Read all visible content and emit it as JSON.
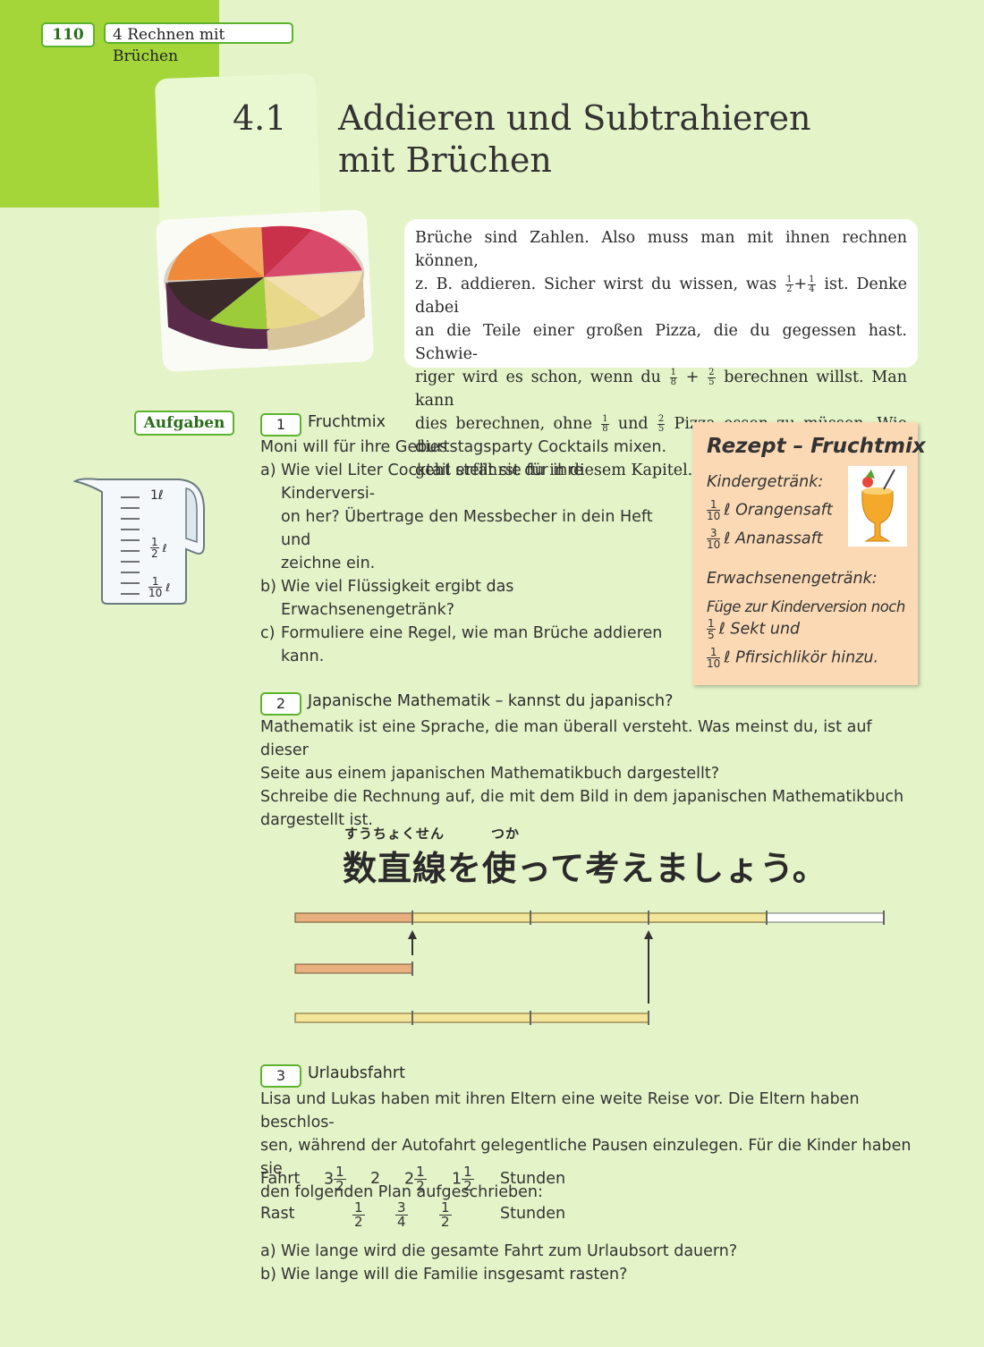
{
  "header": {
    "page_number": "110",
    "chapter": "4 Rechnen mit Brüchen"
  },
  "section": {
    "number": "4.1",
    "title_line1": "Addieren und Subtrahieren",
    "title_line2": "mit Brüchen"
  },
  "intro": {
    "p1": "Brüche sind Zahlen. Also muss man mit ihnen rechnen können,",
    "p2a": "z. B. addieren. Sicher wirst du wissen, was ",
    "p2b": " ist. Denke dabei",
    "p3": "an die Teile einer großen Pizza, die du gegessen hast. Schwie-",
    "p4a": "riger wird es schon, wenn du ",
    "p4b": " berechnen willst. Man kann",
    "p5a": "dies berechnen, ohne ",
    "p5b": " und ",
    "p5c": " Pizza essen zu müssen. Wie dies",
    "p6": "geht erfährst du in diesem Kapitel.",
    "plus": "+",
    "f_half_n": "1",
    "f_half_d": "2",
    "f_quarter_n": "1",
    "f_quarter_d": "4",
    "f_eighth_n": "1",
    "f_eighth_d": "8",
    "f_twofifth_n": "2",
    "f_twofifth_d": "5"
  },
  "aufgaben_label": "Aufgaben",
  "measuring_cup": {
    "label_1": "1ℓ",
    "half_n": "1",
    "half_d": "2",
    "half_unit": "ℓ",
    "tenth_n": "1",
    "tenth_d": "10",
    "tenth_unit": "ℓ"
  },
  "task1": {
    "number": "1",
    "title": "Fruchtmix",
    "intro": "Moni will für ihre Geburtstagsparty Cocktails mixen.",
    "items": [
      {
        "label": "a)",
        "lines": [
          "Wie viel Liter Cocktail stellt sie für ihre Kinderversi-",
          "on her? Übertrage den Messbecher in dein Heft und",
          "zeichne ein."
        ]
      },
      {
        "label": "b)",
        "lines": [
          "Wie viel Flüssigkeit ergibt das Erwachsenengetränk?"
        ]
      },
      {
        "label": "c)",
        "lines": [
          "Formuliere eine Regel, wie man Brüche addieren",
          "kann."
        ]
      }
    ]
  },
  "recipe": {
    "title": "Rezept – Fruchtmix",
    "kids_heading": "Kindergetränk:",
    "kids_1_n": "1",
    "kids_1_d": "10",
    "kids_1_text": "ℓ Orangensaft",
    "kids_2_n": "3",
    "kids_2_d": "10",
    "kids_2_text": "ℓ Ananassaft",
    "adult_heading": "Erwachsenengetränk:",
    "adult_line": "Füge zur Kinderversion noch",
    "adult_1_n": "1",
    "adult_1_d": "5",
    "adult_1_text": "ℓ Sekt und",
    "adult_2_n": "1",
    "adult_2_d": "10",
    "adult_2_text": "ℓ Pfirsichlikör hinzu."
  },
  "task2": {
    "number": "2",
    "title": "Japanische Mathematik – kannst du japanisch?",
    "lines": [
      "Mathematik ist eine Sprache, die man überall versteht. Was meinst du, ist auf dieser",
      "Seite aus einem japanischen Mathematikbuch dargestellt?",
      "Schreibe die Rechnung auf, die mit dem Bild in dem japanischen Mathematikbuch",
      "dargestellt ist."
    ],
    "japanese_ruby_1": "すうちょくせん",
    "japanese_ruby_2": "つか",
    "japanese_text": "数直線を使って考えましょう。"
  },
  "task3": {
    "number": "3",
    "title": "Urlaubsfahrt",
    "lines": [
      "Lisa und Lukas haben mit ihren Eltern eine weite Reise vor. Die Eltern haben beschlos-",
      "sen, während der Autofahrt gelegentliche Pausen einzulegen. Für die Kinder haben sie",
      "den folgenden Plan aufgeschrieben:"
    ],
    "plan": {
      "fahrt_label": "Fahrt",
      "rast_label": "Rast",
      "unit": "Stunden",
      "fahrt": [
        {
          "whole": "3",
          "n": "1",
          "d": "2"
        },
        {
          "whole": "2",
          "n": "",
          "d": ""
        },
        {
          "whole": "2",
          "n": "1",
          "d": "2"
        },
        {
          "whole": "1",
          "n": "1",
          "d": "2"
        }
      ],
      "rast": [
        {
          "n": "1",
          "d": "2"
        },
        {
          "n": "3",
          "d": "4"
        },
        {
          "n": "1",
          "d": "2"
        }
      ]
    },
    "questions": [
      {
        "label": "a)",
        "text": "Wie lange wird die gesamte Fahrt zum Urlaubsort dauern?"
      },
      {
        "label": "b)",
        "text": "Wie lange will die Familie insgesamt rasten?"
      }
    ]
  },
  "colors": {
    "page_bg": "#e4f3c8",
    "accent_green": "#a4d63a",
    "badge_border": "#5cb32e",
    "recipe_bg": "#fbd9b5",
    "bar_orange": "#e7b07e",
    "bar_yellow": "#f3e59a"
  }
}
